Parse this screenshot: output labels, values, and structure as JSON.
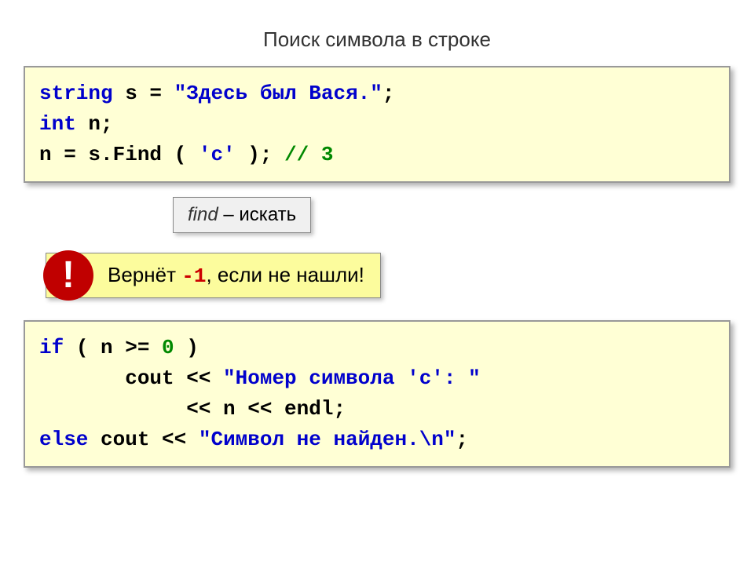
{
  "title": "Поиск символа в строке",
  "code1": {
    "string_kw": "string",
    "var_s": " s = ",
    "str_literal": "\"Здесь был Вася.\"",
    "semi1": ";",
    "int_kw": "int",
    "var_n": " n;",
    "assign": "n = s.Find ( ",
    "char_c": "'с'",
    "close": " );   ",
    "comment": "// 3"
  },
  "note": {
    "find_word": "find",
    "rest": " – искать"
  },
  "alert": {
    "excl": "!",
    "text_before": "Вернёт ",
    "neg1": "-1",
    "text_after": ", если не нашли!"
  },
  "code2": {
    "if_kw": "if",
    "cond": " ( n >= ",
    "zero": "0",
    "cond_close": " )",
    "indent1": "       cout << ",
    "str1": "\"Номер символа 'c': \"",
    "indent2": "            << n << endl;",
    "else_kw": "else",
    "cout2": " cout << ",
    "str2": "\"Символ не найден.\\n\"",
    "semi2": ";"
  }
}
